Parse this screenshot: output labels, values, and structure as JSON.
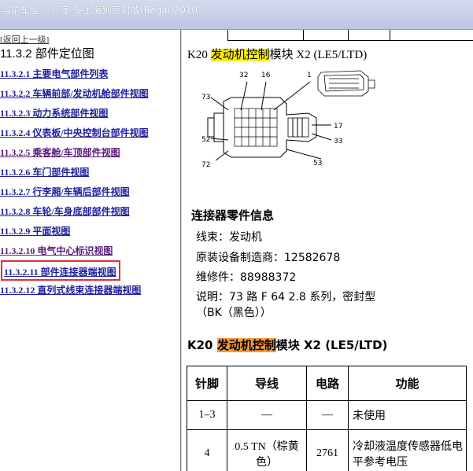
{
  "titlebar": {
    "text": "当前车型：  厂家:S-上海别克君威(Regal)2010"
  },
  "left_nav": {
    "back_link": "[返回上一级]",
    "section_title": "11.3.2 部件定位图",
    "items": [
      {
        "label": "11.3.2.1 主要电气部件列表"
      },
      {
        "label": "11.3.2.2 车辆前部/发动机舱部件视图"
      },
      {
        "label": "11.3.2.3 动力系统部件视图"
      },
      {
        "label": "11.3.2.4 仪表板/中央控制台部件视图"
      },
      {
        "label": "11.3.2.5 乘客舱/车顶部件视图"
      },
      {
        "label": "11.3.2.6 车门部件视图"
      },
      {
        "label": "11.3.2.7 行李厢/车辆后部件视图"
      },
      {
        "label": "11.3.2.8 车轮/车身底部部件视图"
      },
      {
        "label": "11.3.2.9 平面视图"
      },
      {
        "label": "11.3.2.10 电气中心标识视图"
      },
      {
        "label": "11.3.2.11 部件连接器端视图"
      },
      {
        "label": "11.3.2.12 直列式线束连接器端视图"
      }
    ],
    "active_index": 10
  },
  "content": {
    "heading1": {
      "pre": "K20 ",
      "highlight": "发动机控制",
      "post": "模块 X2 (LE5/LTD)"
    },
    "diagram_labels": {
      "p32": "32",
      "p16": "16",
      "p1": "1",
      "p73": "73",
      "p17": "17",
      "p52": "52",
      "p33": "33",
      "p72": "72",
      "p53": "53"
    },
    "info_title": "连接器零件信息",
    "info_lines": [
      "线束：发动机",
      "原装设备制造商：12582678",
      "维修件：88988372",
      "说明：73 路 F 64 2.8 系列，密封型",
      "（BK（黑色））"
    ],
    "heading2": {
      "pre": "K20 ",
      "highlight": "发动机控制",
      "post": "模块 X2 (LE5/LTD)"
    },
    "table": {
      "headers": [
        "针脚",
        "导线",
        "电路",
        "功能"
      ],
      "rows": [
        {
          "pin": "1–3",
          "wire": "—",
          "circuit": "—",
          "function": "未使用"
        },
        {
          "pin": "4",
          "wire": "0.5 TN（棕黄色）",
          "circuit": "2761",
          "function": "冷却液温度传感器低电平参考电压"
        }
      ]
    }
  },
  "colors": {
    "highlight_yellow": "#ffee00",
    "highlight_orange": "#f59a3a",
    "active_box": "#e0303a",
    "link": "#1f1f9e"
  }
}
